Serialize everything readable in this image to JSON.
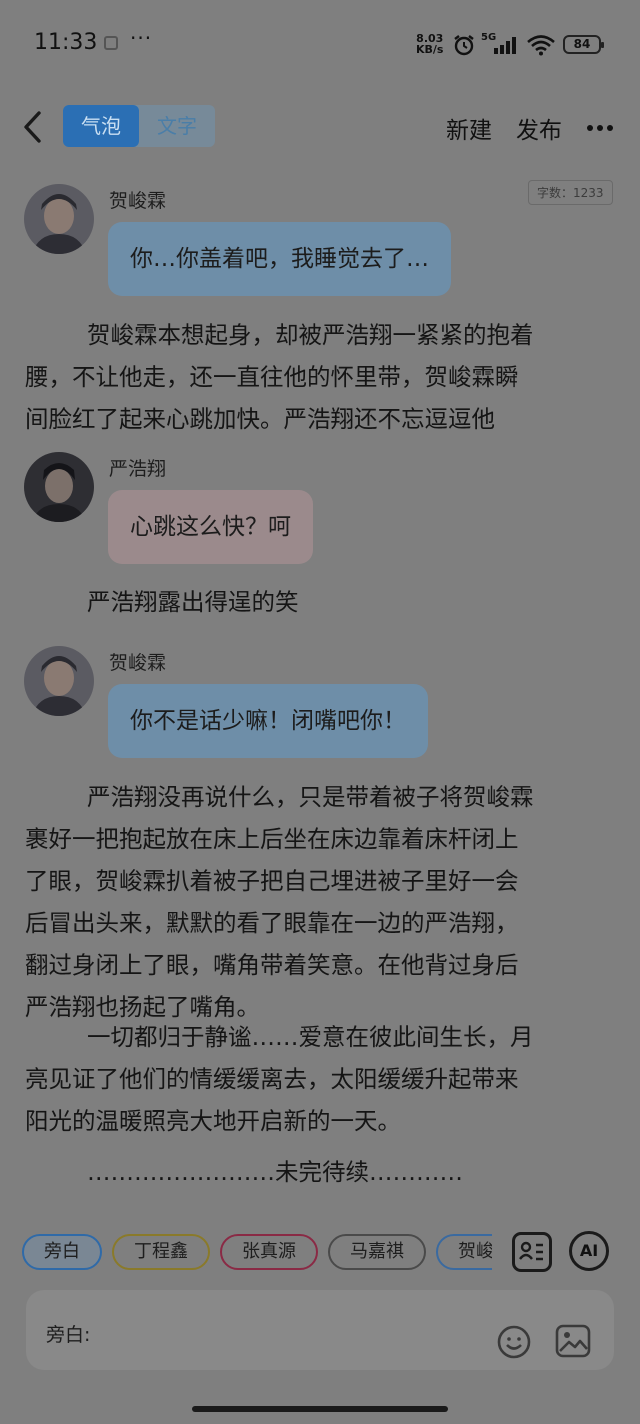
{
  "status_bar": {
    "time": "11:33",
    "more": "···",
    "net_speed_value": "8.03",
    "net_speed_unit": "KB/s",
    "signal_label": "5G",
    "battery": "84"
  },
  "toolbar": {
    "tabs": [
      {
        "label": "气泡",
        "active": true
      },
      {
        "label": "文字",
        "active": false
      }
    ],
    "new_label": "新建",
    "publish_label": "发布"
  },
  "content": {
    "word_count": "字数：1233",
    "blocks": [
      {
        "type": "message",
        "sender": "贺峻霖",
        "text": "你…你盖着吧，我睡觉去了…",
        "bubble_color": "#6e8ea8"
      },
      {
        "type": "narration",
        "lines": [
          "贺峻霖本想起身，却被严浩翔一紧紧的抱着",
          "腰，不让他走，还一直往他的怀里带，贺峻霖瞬",
          "间脸红了起来心跳加快。严浩翔还不忘逗逗他"
        ]
      },
      {
        "type": "message",
        "sender": "严浩翔",
        "text": "心跳这么快？呵",
        "bubble_color": "#9b8a8c"
      },
      {
        "type": "narration",
        "lines": [
          "严浩翔露出得逞的笑"
        ]
      },
      {
        "type": "message",
        "sender": "贺峻霖",
        "text": "你不是话少嘛！闭嘴吧你！",
        "bubble_color": "#6e8ea8"
      },
      {
        "type": "narration",
        "lines": [
          "严浩翔没再说什么，只是带着被子将贺峻霖",
          "裹好一把抱起放在床上后坐在床边靠着床杆闭上",
          "了眼，贺峻霖扒着被子把自己埋进被子里好一会",
          "后冒出头来，默默的看了眼靠在一边的严浩翔，",
          "翻过身闭上了眼，嘴角带着笑意。在他背过身后",
          "严浩翔也扬起了嘴角。"
        ]
      },
      {
        "type": "narration",
        "lines": [
          "一切都归于静谧……爱意在彼此间生长，月",
          "亮见证了他们的情缓缓离去，太阳缓缓升起带来",
          "阳光的温暖照亮大地开启新的一天。"
        ]
      },
      {
        "type": "narration",
        "lines": [
          "……………………未完待续…………"
        ]
      }
    ]
  },
  "role_chips": [
    {
      "label": "旁白",
      "selected": true
    },
    {
      "label": "丁程鑫",
      "selected": false
    },
    {
      "label": "张真源",
      "selected": false
    },
    {
      "label": "马嘉祺",
      "selected": false
    },
    {
      "label": "贺峻霖",
      "selected": false
    }
  ],
  "ai_label": "AI",
  "input": {
    "label": "旁白:",
    "value": "",
    "placeholder": ""
  },
  "icons": [
    "back-icon",
    "more-icon",
    "alarm-icon",
    "signal-icon",
    "wifi-icon",
    "roles-icon",
    "emoji-icon",
    "image-icon"
  ]
}
